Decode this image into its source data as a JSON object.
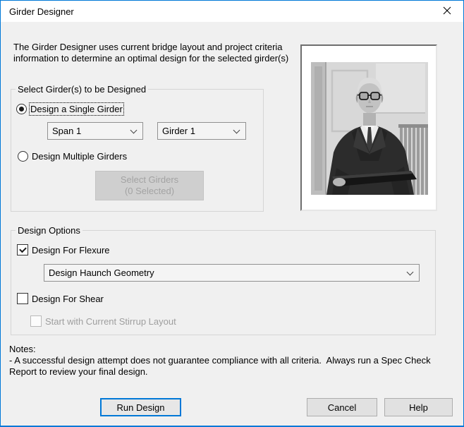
{
  "window": {
    "title": "Girder Designer"
  },
  "intro": {
    "text": "The Girder Designer uses current bridge layout and project criteria information to determine an optimal design for the selected girder(s)"
  },
  "girder_group": {
    "title": "Select Girder(s) to be Designed",
    "single_radio": {
      "label": "Design a Single Girder",
      "selected": true
    },
    "span_dropdown": {
      "value": "Span 1"
    },
    "girder_dropdown": {
      "value": "Girder 1"
    },
    "multiple_radio": {
      "label": "Design Multiple Girders",
      "selected": false
    },
    "select_girders_button": {
      "line1": "Select Girders",
      "line2": "(0 Selected)",
      "enabled": false
    }
  },
  "options_group": {
    "title": "Design Options",
    "flexure_checkbox": {
      "label": "Design For Flexure",
      "checked": true
    },
    "haunch_dropdown": {
      "value": "Design Haunch Geometry"
    },
    "shear_checkbox": {
      "label": "Design For Shear",
      "checked": false
    },
    "stirrup_checkbox": {
      "label": "Start with Current Stirrup Layout",
      "checked": false,
      "enabled": false
    }
  },
  "notes": {
    "heading": "Notes:",
    "line1": "- A successful design attempt does not guarantee compliance with all criteria.  Always run a Spec Check",
    "line2": "Report to review your final design."
  },
  "footer": {
    "run": "Run Design",
    "cancel": "Cancel",
    "help": "Help"
  },
  "photo": {
    "description": "black-and-white portrait of an elderly engineer with glasses holding a book"
  },
  "colors": {
    "accent": "#0078d7",
    "dialog_bg": "#f0f0f0",
    "disabled_text": "#9e9e9e"
  }
}
